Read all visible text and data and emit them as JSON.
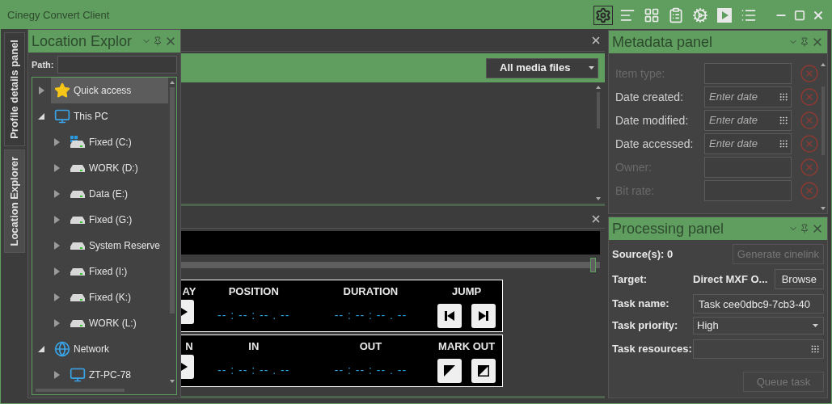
{
  "window": {
    "title": "Cinegy Convert Client",
    "toolbar": [
      {
        "kind": "settings",
        "selected": true
      },
      {
        "kind": "lines",
        "selected": false
      },
      {
        "kind": "grid",
        "selected": false
      },
      {
        "kind": "clipboard",
        "selected": false
      },
      {
        "kind": "cogs",
        "selected": false
      },
      {
        "kind": "play",
        "selected": false
      },
      {
        "kind": "list",
        "selected": false
      }
    ]
  },
  "side_tabs": [
    {
      "label": "Profile details panel",
      "selected": false
    },
    {
      "label": "Location Explorer",
      "selected": true
    }
  ],
  "location_explorer": {
    "title": "Location Explor",
    "path_label": "Path:",
    "tree": [
      {
        "label": "Quick access",
        "kind": "star",
        "selected": true,
        "expanded": false
      },
      {
        "label": "This PC",
        "kind": "computer",
        "selected": false,
        "expanded": true,
        "children": [
          {
            "label": "Fixed (C:)",
            "kind": "system_drive",
            "selected": false,
            "expanded": false
          },
          {
            "label": "WORK (D:)",
            "kind": "drive",
            "selected": false,
            "expanded": false
          },
          {
            "label": "Data (E:)",
            "kind": "drive",
            "selected": false,
            "expanded": false
          },
          {
            "label": "Fixed (G:)",
            "kind": "drive",
            "selected": false,
            "expanded": false
          },
          {
            "label": "System Reserve",
            "kind": "drive",
            "selected": false,
            "expanded": false
          },
          {
            "label": "Fixed (I:)",
            "kind": "drive",
            "selected": false,
            "expanded": false
          },
          {
            "label": "Fixed (K:)",
            "kind": "drive",
            "selected": false,
            "expanded": false
          },
          {
            "label": "WORK (L:)",
            "kind": "drive",
            "selected": false,
            "expanded": false
          }
        ]
      },
      {
        "label": "Network",
        "kind": "network",
        "selected": false,
        "expanded": true,
        "children": [
          {
            "label": "ZT-PC-78",
            "kind": "computer",
            "selected": false,
            "expanded": false
          }
        ]
      }
    ]
  },
  "media_browser": {
    "filter": "All media files"
  },
  "player": {
    "seek": {
      "level": 0.99
    },
    "transport": [
      {
        "columns": [
          {
            "heading": "AY",
            "kind": "partial_button"
          },
          {
            "heading": "POSITION",
            "kind": "timecode",
            "value": "-- : -- : -- . --"
          },
          {
            "heading": "DURATION",
            "kind": "timecode",
            "value": "-- : -- : -- . --"
          },
          {
            "heading": "JUMP",
            "kind": "buttons",
            "buttons": [
              {
                "kind": "jump_start"
              },
              {
                "kind": "jump_end"
              }
            ]
          }
        ]
      },
      {
        "columns": [
          {
            "heading": "N",
            "kind": "partial_button"
          },
          {
            "heading": "IN",
            "kind": "timecode",
            "value": "-- : -- : -- . --"
          },
          {
            "heading": "OUT",
            "kind": "timecode",
            "value": "-- : -- : -- . --"
          },
          {
            "heading": "MARK OUT",
            "kind": "buttons",
            "buttons": [
              {
                "kind": "mark_full"
              },
              {
                "kind": "mark_half"
              }
            ]
          }
        ]
      }
    ]
  },
  "metadata_panel": {
    "title": "Metadata panel",
    "rows": [
      {
        "label": "Item type:",
        "disabled": true
      },
      {
        "label": "Date created:",
        "disabled": false,
        "placeholder": "Enter date"
      },
      {
        "label": "Date modified:",
        "disabled": false,
        "placeholder": "Enter date"
      },
      {
        "label": "Date accessed:",
        "disabled": false,
        "placeholder": "Enter date"
      },
      {
        "label": "Owner:",
        "disabled": true
      },
      {
        "label": "Bit rate:",
        "disabled": true
      }
    ]
  },
  "processing_panel": {
    "title": "Processing panel",
    "sources": "Source(s): 0",
    "generate_button": {
      "label": "Generate cinelink",
      "disabled": true
    },
    "target_label": "Target:",
    "target_value": "Direct MXF O...",
    "browse_button": "Browse",
    "task_name_label": "Task name:",
    "task_name": "Task cee0dbc9-7cb3-40",
    "priority_label": "Task priority:",
    "priority": "High",
    "resources_label": "Task resources:",
    "queue_button": {
      "label": "Queue task",
      "disabled": true
    }
  }
}
